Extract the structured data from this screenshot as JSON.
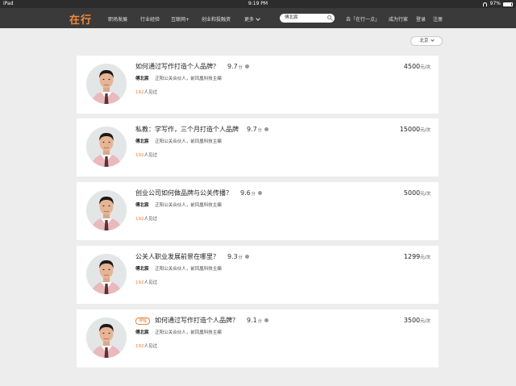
{
  "statusbar": {
    "device": "iPad",
    "time": "9:19 PM",
    "battery": "97%"
  },
  "navbar": {
    "logo": "在行",
    "items": [
      "职场发展",
      "行业经验",
      "互联网+",
      "创业和投融资"
    ],
    "more": "更多",
    "search_value": "傅北宸",
    "right_links": [
      "去「在行一点」",
      "成为行家",
      "登录",
      "注册"
    ]
  },
  "city_selector": {
    "label": "北京"
  },
  "cards": [
    {
      "tag": "",
      "title": "如何通过写作打造个人品牌？",
      "score": "9.7",
      "score_unit": "分",
      "author": "傅北宸",
      "desc": "正阳公关合伙人，前凤凰科技主编",
      "met_count": "192",
      "met_text": "人见过",
      "price": "4500",
      "price_unit": "元/次"
    },
    {
      "tag": "",
      "title": "私教：学写作，三个月打造个人品牌",
      "score": "9.7",
      "score_unit": "分",
      "author": "傅北宸",
      "desc": "正阳公关合伙人，前凤凰科技主编",
      "met_count": "192",
      "met_text": "人见过",
      "price": "15000",
      "price_unit": "元/次"
    },
    {
      "tag": "",
      "title": "创业公司如何做品牌与公关传播？",
      "score": "9.6",
      "score_unit": "分",
      "author": "傅北宸",
      "desc": "正阳公关合伙人，前凤凰科技主编",
      "met_count": "192",
      "met_text": "人见过",
      "price": "5000",
      "price_unit": "元/次"
    },
    {
      "tag": "",
      "title": "公关人职业发展前景在哪里？",
      "score": "9.3",
      "score_unit": "分",
      "author": "傅北宸",
      "desc": "正阳公关合伙人，前凤凰科技主编",
      "met_count": "192",
      "met_text": "人见过",
      "price": "1299",
      "price_unit": "元/次"
    },
    {
      "tag": "课程",
      "title": "如何通过写作打造个人品牌？",
      "score": "9.1",
      "score_unit": "分",
      "author": "傅北宸",
      "desc": "正阳公关合伙人，前凤凰科技主编",
      "met_count": "192",
      "met_text": "人见过",
      "price": "3500",
      "price_unit": "元/次"
    }
  ]
}
